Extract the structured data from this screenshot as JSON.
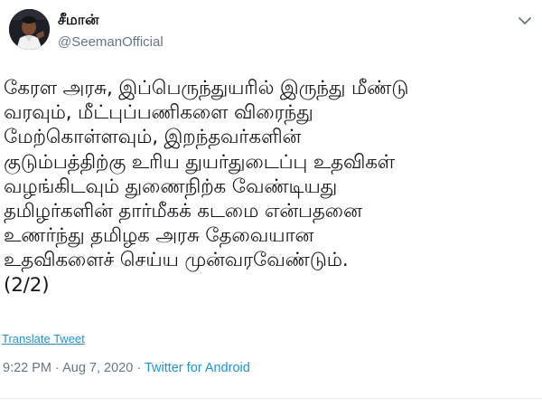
{
  "user": {
    "display_name": "சீமான்",
    "handle": "@SeemanOfficial"
  },
  "tweet": {
    "lines": [
      "கேரள அரசு, இப்பெருந்துயரில் இருந்து மீண்டு",
      "வரவும், மீட்புப்பணிகளை விரைந்து",
      "மேற்கொள்ளவும், இறந்தவர்களின்",
      "குடும்பத்திற்கு உரிய துயர்துடைப்பு உதவிகள்",
      "வழங்கிடவும் துணைநிற்க வேண்டியது",
      "தமிழர்களின் தார்மீகக் கடமை என்பதனை",
      "உணர்ந்து தமிழக அரசு தேவையான",
      "உதவிகளைச் செய்ய முன்வரவேண்டும்.",
      "(2/2)"
    ],
    "translate_label": "Translate Tweet"
  },
  "meta": {
    "time": "9:22 PM",
    "separator1": " · ",
    "date": "Aug 7, 2020",
    "separator2": " · ",
    "source": "Twitter for Android"
  },
  "icons": {
    "avatar": "profile-photo",
    "caret": "chevron-down-icon"
  },
  "colors": {
    "text": "#14171a",
    "secondary": "#657786",
    "link": "#1b95e0"
  }
}
